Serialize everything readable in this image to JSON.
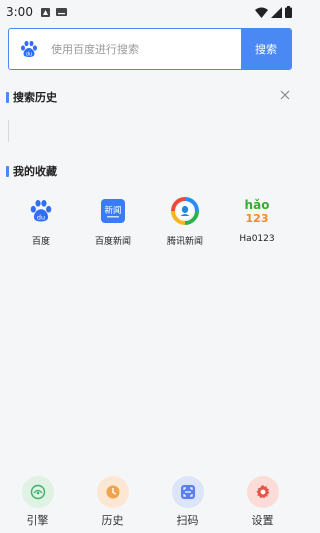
{
  "status": {
    "time": "3:00"
  },
  "search": {
    "placeholder": "使用百度进行搜索",
    "button_label": "搜索",
    "engine_icon": "baidu-paw-icon"
  },
  "history": {
    "title": "搜索历史",
    "clear_icon": "close-icon"
  },
  "favorites": {
    "title": "我的收藏",
    "items": [
      {
        "label": "百度",
        "icon": "baidu-icon"
      },
      {
        "label": "百度新闻",
        "icon": "baidu-news-icon",
        "icon_text": "新闻"
      },
      {
        "label": "腾讯新闻",
        "icon": "tencent-news-icon"
      },
      {
        "label": "Ha0123",
        "icon": "hao123-icon",
        "icon_text_top": "hǎo",
        "icon_text_bottom": "123"
      }
    ]
  },
  "bottom_nav": [
    {
      "label": "引擎",
      "icon": "engine-icon",
      "color": "#dff2e4"
    },
    {
      "label": "历史",
      "icon": "clock-icon",
      "color": "#fbe7d3"
    },
    {
      "label": "扫码",
      "icon": "scan-icon",
      "color": "#dde5fb"
    },
    {
      "label": "设置",
      "icon": "gear-icon",
      "color": "#fbdcd8"
    }
  ],
  "colors": {
    "accent": "#4a89f3",
    "background": "#f5f6f8"
  }
}
